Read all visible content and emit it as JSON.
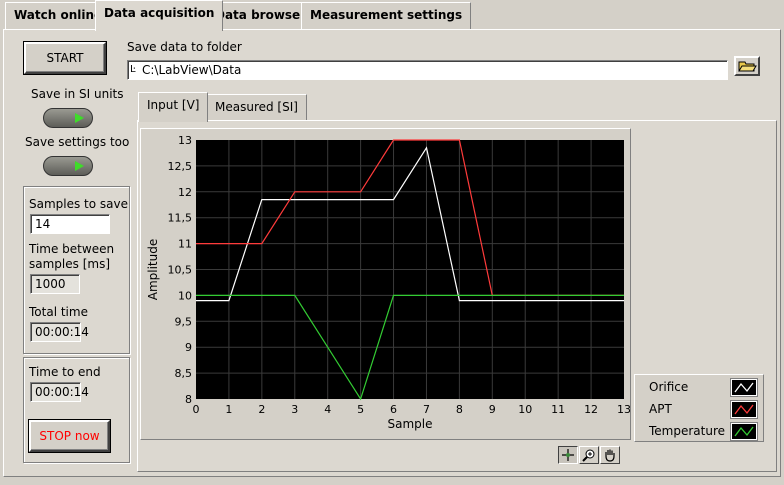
{
  "tabs": [
    "Watch online",
    "Data acquisition",
    "Data browser",
    "Measurement settings"
  ],
  "controls": {
    "start_label": "START",
    "save_si_label": "Save in SI units",
    "save_settings_label": "Save settings too",
    "folder_label": "Save data to folder",
    "folder_path": "C:\\LabView\\Data",
    "samples_label": "Samples to save",
    "samples_value": "14",
    "time_between_label_1": "Time between",
    "time_between_label_2": "samples [ms]",
    "time_between_value": "1000",
    "total_time_label": "Total time",
    "total_time_value": "00:00:14",
    "time_to_end_label": "Time to end",
    "time_to_end_value": "00:00:14",
    "stop_label": "STOP now"
  },
  "sub_tabs": [
    "Input [V]",
    "Measured [SI]"
  ],
  "colors": {
    "orifice": "#ffffff",
    "apt": "#ff3b3b",
    "temperature": "#33cc33",
    "plot_bg": "#000000",
    "grid": "#3a3a3a",
    "stop_text": "#ff0000"
  },
  "icons": [
    "folder-icon",
    "crosshair-icon",
    "zoom-icon",
    "pan-hand-icon"
  ],
  "chart_data": {
    "type": "line",
    "xlabel": "Sample",
    "ylabel": "Amplitude",
    "xlim": [
      0,
      13
    ],
    "ylim": [
      8,
      13
    ],
    "xticks": [
      "0",
      "1",
      "2",
      "3",
      "4",
      "5",
      "6",
      "7",
      "8",
      "9",
      "10",
      "11",
      "12",
      "13"
    ],
    "yticks": [
      "8",
      "8,5",
      "9",
      "9,5",
      "10",
      "10,5",
      "11",
      "11,5",
      "12",
      "12,5",
      "13"
    ],
    "grid": true,
    "legend_position": "bottom-right",
    "series": [
      {
        "name": "Orifice",
        "color": "#ffffff",
        "x": [
          0,
          1,
          2,
          3,
          4,
          5,
          6,
          7,
          8,
          9,
          10,
          11,
          12,
          13
        ],
        "y": [
          9.9,
          9.9,
          11.85,
          11.85,
          11.85,
          11.85,
          11.85,
          12.85,
          9.9,
          9.9,
          9.9,
          9.9,
          9.9,
          9.9
        ]
      },
      {
        "name": "APT",
        "color": "#ff3b3b",
        "x": [
          0,
          1,
          2,
          3,
          4,
          5,
          6,
          7,
          8,
          9,
          10,
          11,
          12,
          13
        ],
        "y": [
          11,
          11,
          11,
          12,
          12,
          12,
          13,
          13,
          13,
          10,
          10,
          10,
          10,
          10
        ]
      },
      {
        "name": "Temperature",
        "color": "#33cc33",
        "x": [
          0,
          1,
          2,
          3,
          4,
          5,
          6,
          7,
          8,
          9,
          10,
          11,
          12,
          13
        ],
        "y": [
          10,
          10,
          10,
          10,
          9,
          8,
          10,
          10,
          10,
          10,
          10,
          10,
          10,
          10
        ]
      }
    ]
  }
}
